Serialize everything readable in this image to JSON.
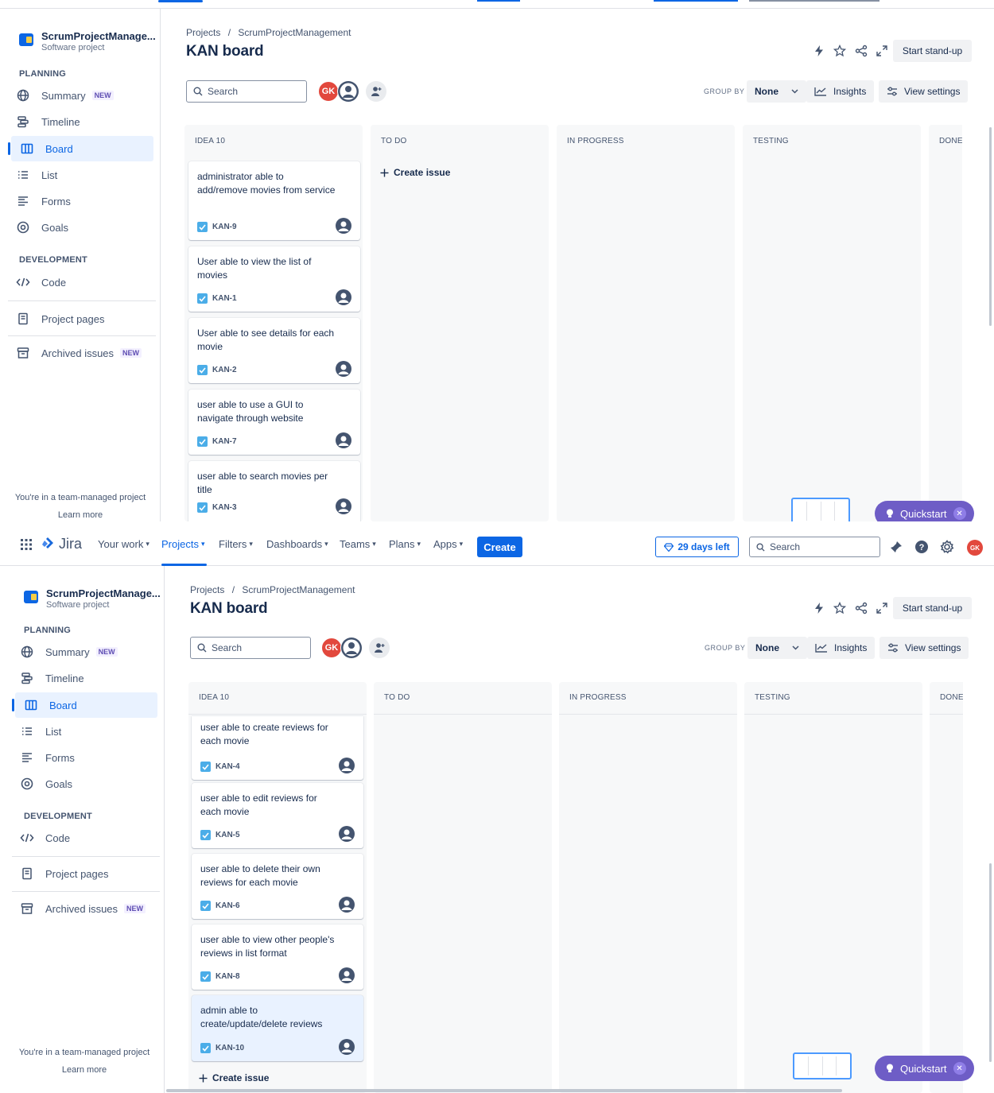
{
  "nav": {
    "app_name": "Jira",
    "items": [
      {
        "label": "Your work"
      },
      {
        "label": "Projects"
      },
      {
        "label": "Filters"
      },
      {
        "label": "Dashboards"
      },
      {
        "label": "Teams"
      },
      {
        "label": "Plans"
      },
      {
        "label": "Apps"
      }
    ],
    "create_label": "Create",
    "trial_label": "29 days left",
    "search_placeholder": "Search",
    "avatar_initials": "GK"
  },
  "sidebar": {
    "project_name": "ScrumProjectManage...",
    "project_type": "Software project",
    "planning_label": "PLANNING",
    "development_label": "DEVELOPMENT",
    "items": [
      {
        "label": "Summary",
        "badge": "NEW"
      },
      {
        "label": "Timeline"
      },
      {
        "label": "Board"
      },
      {
        "label": "List"
      },
      {
        "label": "Forms"
      },
      {
        "label": "Goals"
      },
      {
        "label": "Code"
      },
      {
        "label": "Project pages"
      },
      {
        "label": "Archived issues",
        "badge": "NEW"
      }
    ],
    "footer_text": "You're in a team-managed project",
    "learn_more": "Learn more"
  },
  "header": {
    "breadcrumb_root": "Projects",
    "breadcrumb_sep": "/",
    "breadcrumb_project": "ScrumProjectManagement",
    "title": "KAN board",
    "standup_label": "Start stand-up"
  },
  "toolbar": {
    "search_placeholder": "Search",
    "avatar_initials": "GK",
    "group_by_label": "GROUP BY",
    "group_by_value": "None",
    "insights_label": "Insights",
    "view_settings_label": "View settings"
  },
  "board": {
    "columns": [
      "IDEA 10",
      "TO DO",
      "IN PROGRESS",
      "TESTING",
      "DONE"
    ],
    "create_issue_label": "Create issue"
  },
  "issues_pane1": [
    {
      "title": "administrator able to add/remove movies from service",
      "key": "KAN-9"
    },
    {
      "title": "User able to view the list of movies",
      "key": "KAN-1"
    },
    {
      "title": "User able to see details for each movie",
      "key": "KAN-2"
    },
    {
      "title": "user able to use a GUI to navigate through website",
      "key": "KAN-7"
    },
    {
      "title": "user able to search movies per title",
      "key": "KAN-3"
    }
  ],
  "issues_pane2": [
    {
      "title": "user able to create reviews for each movie",
      "key": "KAN-4"
    },
    {
      "title": "user able to edit reviews for each movie",
      "key": "KAN-5"
    },
    {
      "title": "user able to delete their own reviews for each movie",
      "key": "KAN-6"
    },
    {
      "title": "user able to view other people's reviews in list format",
      "key": "KAN-8"
    },
    {
      "title": "admin able to create/update/delete reviews",
      "key": "KAN-10"
    }
  ],
  "quickstart_label": "Quickstart",
  "colors": {
    "brand": "#0c66e4",
    "avatar": "#e2483d",
    "quickstart": "#6e5dc6",
    "column_bg": "#f7f8f9"
  }
}
